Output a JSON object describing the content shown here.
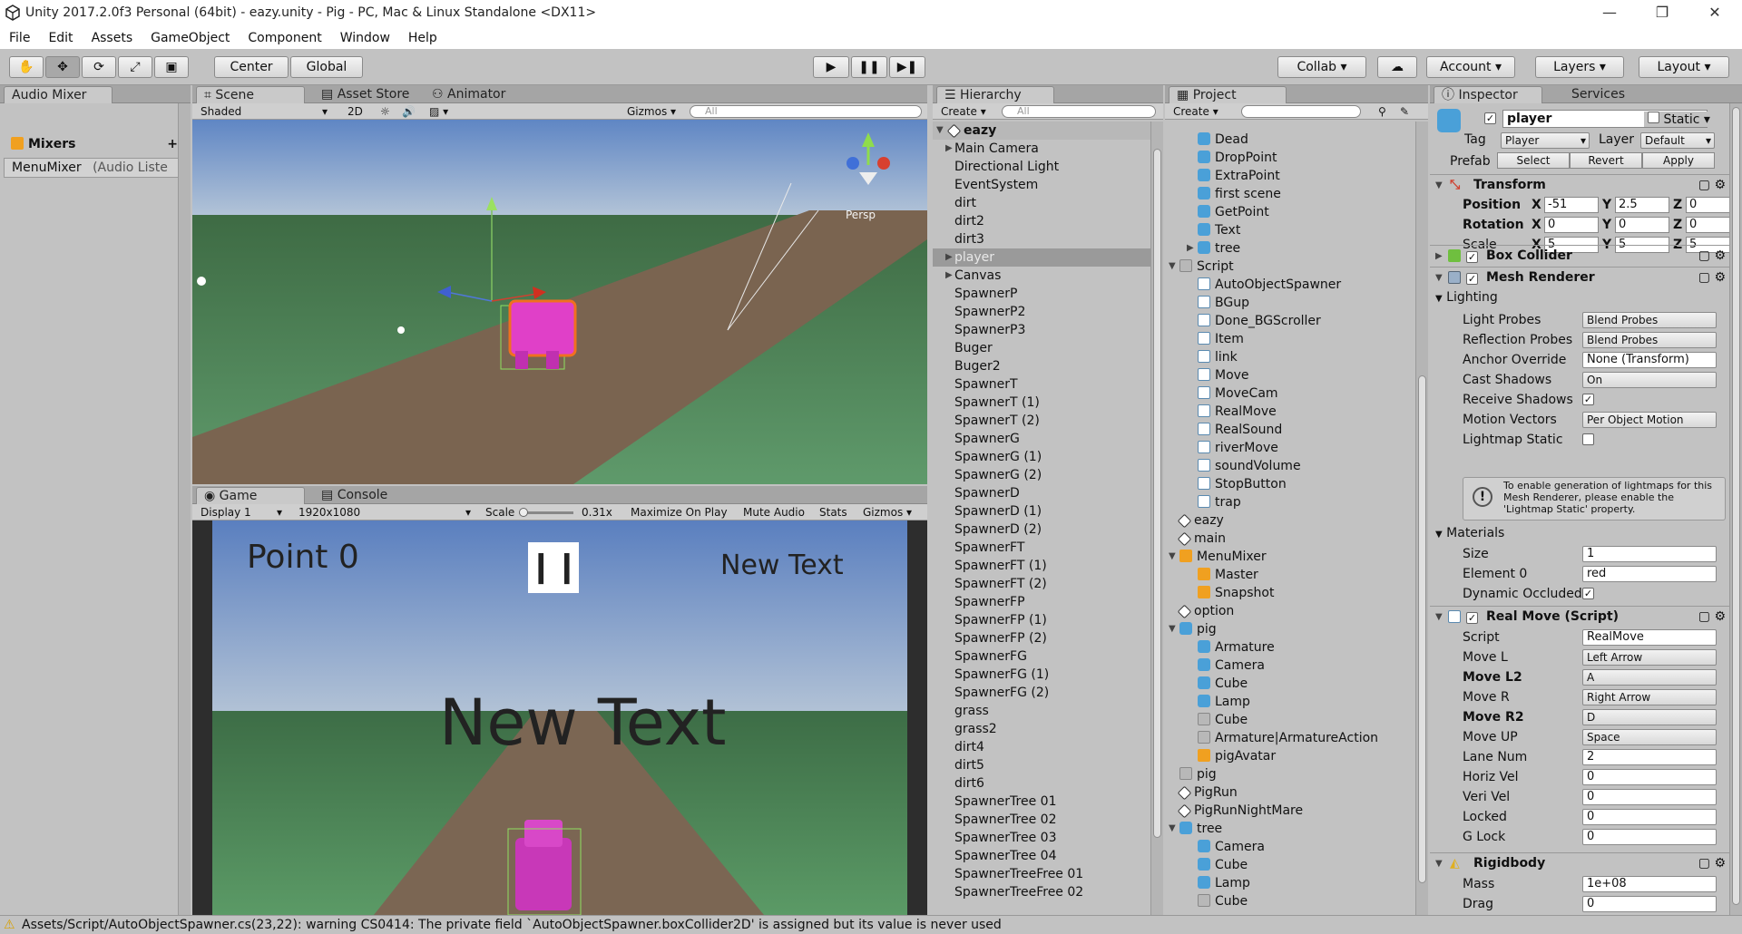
{
  "window": {
    "title": "Unity 2017.2.0f3 Personal (64bit) - eazy.unity - Pig - PC, Mac & Linux Standalone <DX11>",
    "minimize": "—",
    "maximize": "❐",
    "close": "✕"
  },
  "menu": [
    "File",
    "Edit",
    "Assets",
    "GameObject",
    "Component",
    "Window",
    "Help"
  ],
  "toolbar": {
    "center": "Center",
    "global": "Global",
    "play": "▶",
    "pause": "❚❚",
    "step": "▶❚",
    "collab": "Collab",
    "account": "Account",
    "layers": "Layers",
    "layout": "Layout"
  },
  "audio_mixer": {
    "tab": "Audio Mixer",
    "mixers": "Mixers",
    "add": "+",
    "item": "MenuMixer",
    "item_note": "(Audio Liste"
  },
  "scene": {
    "tabs": [
      "Scene",
      "Asset Store",
      "Animator"
    ],
    "shading": "Shaded",
    "mode2d": "2D",
    "gizmos": "Gizmos",
    "search": "All",
    "persp": "Persp"
  },
  "game": {
    "tabs": [
      "Game",
      "Console"
    ],
    "display": "Display 1",
    "resolution": "1920x1080",
    "scale_label": "Scale",
    "scale_value": "0.31x",
    "maximize": "Maximize On Play",
    "mute": "Mute Audio",
    "stats": "Stats",
    "gizmos": "Gizmos",
    "point_text": "Point 0",
    "corner_text": "New Text",
    "center_text": "New Text",
    "pause_glyph": "❙❙"
  },
  "hierarchy": {
    "tab": "Hierarchy",
    "create": "Create",
    "search": "All",
    "scene": "eazy",
    "items": [
      "Main Camera",
      "Directional Light",
      "EventSystem",
      "dirt",
      "dirt2",
      "dirt3",
      "player",
      "Canvas",
      "SpawnerP",
      "SpawnerP2",
      "SpawnerP3",
      "Buger",
      "Buger2",
      "SpawnerT",
      "SpawnerT (1)",
      "SpawnerT (2)",
      "SpawnerG",
      "SpawnerG (1)",
      "SpawnerG (2)",
      "SpawnerD",
      "SpawnerD (1)",
      "SpawnerD (2)",
      "SpawnerFT",
      "SpawnerFT (1)",
      "SpawnerFT (2)",
      "SpawnerFP",
      "SpawnerFP (1)",
      "SpawnerFP (2)",
      "SpawnerFG",
      "SpawnerFG (1)",
      "SpawnerFG (2)",
      "grass",
      "grass2",
      "dirt4",
      "dirt5",
      "dirt6",
      "SpawnerTree 01",
      "SpawnerTree 02",
      "SpawnerTree 03",
      "SpawnerTree 04",
      "SpawnerTreeFree 01",
      "SpawnerTreeFree 02"
    ]
  },
  "project": {
    "tab": "Project",
    "create": "Create",
    "items": [
      {
        "name": "Dead",
        "icon": "cube",
        "indent": 1
      },
      {
        "name": "DropPoint",
        "icon": "cube",
        "indent": 1
      },
      {
        "name": "ExtraPoint",
        "icon": "cube",
        "indent": 1
      },
      {
        "name": "first scene",
        "icon": "cube",
        "indent": 1
      },
      {
        "name": "GetPoint",
        "icon": "cube",
        "indent": 1
      },
      {
        "name": "Text",
        "icon": "cube",
        "indent": 1
      },
      {
        "name": "tree",
        "icon": "cube",
        "indent": 1,
        "arrow": "▶"
      },
      {
        "name": "Script",
        "icon": "folder",
        "indent": 0,
        "arrow": "▼"
      },
      {
        "name": "AutoObjectSpawner",
        "icon": "script",
        "indent": 1
      },
      {
        "name": "BGup",
        "icon": "script",
        "indent": 1
      },
      {
        "name": "Done_BGScroller",
        "icon": "script",
        "indent": 1
      },
      {
        "name": "Item",
        "icon": "script",
        "indent": 1
      },
      {
        "name": "link",
        "icon": "script",
        "indent": 1
      },
      {
        "name": "Move",
        "icon": "script",
        "indent": 1
      },
      {
        "name": "MoveCam",
        "icon": "script",
        "indent": 1
      },
      {
        "name": "RealMove",
        "icon": "script",
        "indent": 1
      },
      {
        "name": "RealSound",
        "icon": "script",
        "indent": 1
      },
      {
        "name": "riverMove",
        "icon": "script",
        "indent": 1
      },
      {
        "name": "soundVolume",
        "icon": "script",
        "indent": 1
      },
      {
        "name": "StopButton",
        "icon": "script",
        "indent": 1
      },
      {
        "name": "trap",
        "icon": "script",
        "indent": 1
      },
      {
        "name": "eazy",
        "icon": "unity",
        "indent": 0
      },
      {
        "name": "main",
        "icon": "unity",
        "indent": 0
      },
      {
        "name": "MenuMixer",
        "icon": "mixer",
        "indent": 0,
        "arrow": "▼"
      },
      {
        "name": "Master",
        "icon": "mixer",
        "indent": 1
      },
      {
        "name": "Snapshot",
        "icon": "mixer",
        "indent": 1
      },
      {
        "name": "option",
        "icon": "unity",
        "indent": 0
      },
      {
        "name": "pig",
        "icon": "cube",
        "indent": 0,
        "arrow": "▼"
      },
      {
        "name": "Armature",
        "icon": "cube",
        "indent": 1
      },
      {
        "name": "Camera",
        "icon": "cube",
        "indent": 1
      },
      {
        "name": "Cube",
        "icon": "cube",
        "indent": 1
      },
      {
        "name": "Lamp",
        "icon": "cube",
        "indent": 1
      },
      {
        "name": "Cube",
        "icon": "folder",
        "indent": 1
      },
      {
        "name": "Armature|ArmatureAction",
        "icon": "folder",
        "indent": 1
      },
      {
        "name": "pigAvatar",
        "icon": "mixer",
        "indent": 1
      },
      {
        "name": "pig",
        "icon": "folder",
        "indent": 0
      },
      {
        "name": "PigRun",
        "icon": "unity",
        "indent": 0
      },
      {
        "name": "PigRunNightMare",
        "icon": "unity",
        "indent": 0
      },
      {
        "name": "tree",
        "icon": "cube",
        "indent": 0,
        "arrow": "▼"
      },
      {
        "name": "Camera",
        "icon": "cube",
        "indent": 1
      },
      {
        "name": "Cube",
        "icon": "cube",
        "indent": 1
      },
      {
        "name": "Lamp",
        "icon": "cube",
        "indent": 1
      },
      {
        "name": "Cube",
        "icon": "folder",
        "indent": 1
      }
    ]
  },
  "inspector": {
    "tabs": [
      "Inspector",
      "Services"
    ],
    "name": "player",
    "static": "Static",
    "tag_label": "Tag",
    "tag": "Player",
    "layer_label": "Layer",
    "layer": "Default",
    "prefab_label": "Prefab",
    "select": "Select",
    "revert": "Revert",
    "apply": "Apply",
    "transform": {
      "title": "Transform",
      "position": "Position",
      "rotation": "Rotation",
      "scale": "Scale",
      "pos": {
        "x": "-51",
        "y": "2.5",
        "z": "0"
      },
      "rot": {
        "x": "0",
        "y": "0",
        "z": "0"
      },
      "scl": {
        "x": "5",
        "y": "5",
        "z": "5"
      }
    },
    "box_collider": "Box Collider",
    "mesh_renderer": "Mesh Renderer",
    "lighting": "Lighting",
    "mr_rows": [
      {
        "label": "Light Probes",
        "value": "Blend Probes"
      },
      {
        "label": "Reflection Probes",
        "value": "Blend Probes"
      },
      {
        "label": "Anchor Override",
        "value": "None (Transform)"
      },
      {
        "label": "Cast Shadows",
        "value": "On"
      },
      {
        "label": "Receive Shadows",
        "value": "✓"
      },
      {
        "label": "Motion Vectors",
        "value": "Per Object Motion"
      },
      {
        "label": "Lightmap Static",
        "value": ""
      }
    ],
    "lightmap_note": "To enable generation of lightmaps for this Mesh Renderer, please enable the 'Lightmap Static' property.",
    "materials": "Materials",
    "mat_rows": [
      {
        "label": "Size",
        "value": "1"
      },
      {
        "label": "Element 0",
        "value": "red"
      },
      {
        "label": "Dynamic Occluded",
        "value": "✓"
      }
    ],
    "real_move": "Real Move (Script)",
    "rm_rows": [
      {
        "label": "Script",
        "value": "RealMove"
      },
      {
        "label": "Move L",
        "value": "Left Arrow"
      },
      {
        "label": "Move L2",
        "value": "A"
      },
      {
        "label": "Move R",
        "value": "Right Arrow"
      },
      {
        "label": "Move R2",
        "value": "D"
      },
      {
        "label": "Move UP",
        "value": "Space"
      },
      {
        "label": "Lane Num",
        "value": "2"
      },
      {
        "label": "Horiz Vel",
        "value": "0"
      },
      {
        "label": "Veri Vel",
        "value": "0"
      },
      {
        "label": "Locked",
        "value": "0"
      },
      {
        "label": "G Lock",
        "value": "0"
      }
    ],
    "rigidbody": "Rigidbody",
    "rb_rows": [
      {
        "label": "Mass",
        "value": "1e+08"
      },
      {
        "label": "Drag",
        "value": "0"
      }
    ]
  },
  "status": "Assets/Script/AutoObjectSpawner.cs(23,22): warning CS0414: The private field `AutoObjectSpawner.boxCollider2D' is assigned but its value is never used"
}
